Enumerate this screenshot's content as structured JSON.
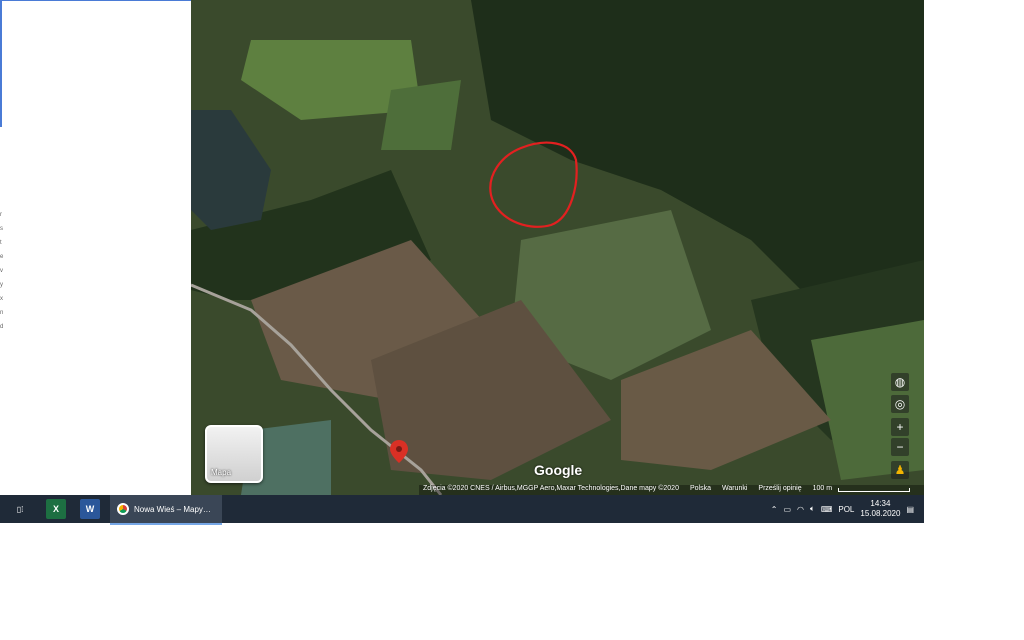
{
  "map": {
    "google_logo": "Google",
    "attribution": "Zdjęcia ©2020 CNES / Airbus,MGGP Aero,Maxar Technologies,Dane mapy ©2020",
    "links": [
      "Polska",
      "Warunki",
      "Prześlij opinię"
    ],
    "scale_label": "100 m",
    "layer_button_label": "Mapa",
    "controls": {
      "zoom_in": "+",
      "zoom_out": "−"
    }
  },
  "left_panel": {
    "fragments": [
      "r",
      "s",
      "t",
      "e",
      "v",
      "y",
      "x",
      "n",
      "d"
    ]
  },
  "taskbar": {
    "apps": [
      {
        "name": "Task View",
        "icon": "task-view-icon"
      },
      {
        "name": "Excel",
        "icon": "excel-icon"
      },
      {
        "name": "Word",
        "icon": "word-icon"
      }
    ],
    "active_window": "Nowa Wieś – Mapy…",
    "tray": {
      "language": "POL",
      "time": "14:34",
      "date": "15.08.2020"
    }
  },
  "colors": {
    "taskbar_bg": "#1f2a38",
    "marker": "#d93025",
    "annotation": "#e32020"
  }
}
